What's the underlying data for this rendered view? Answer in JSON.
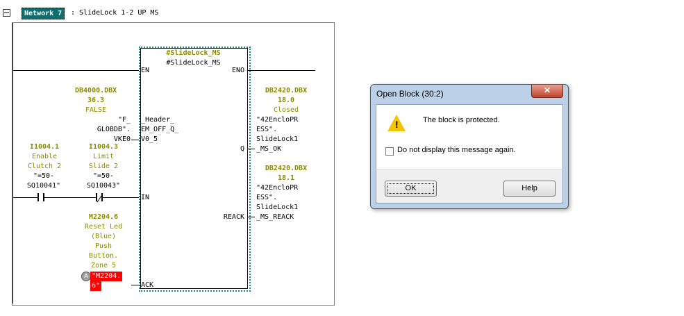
{
  "network": {
    "tag": "Network 7",
    "title": ": SlideLock 1-2 UP MS"
  },
  "block": {
    "instance_db": "#SlideLock_MS",
    "instance_name": "#SlideLock_MS",
    "pin_en": "EN",
    "pin_eno": "ENO",
    "pin_header": "_Header_\nEM_OFF_Q_\nV0_5",
    "pin_q": "Q",
    "pin_in": "IN",
    "pin_reack": "REACK",
    "pin_ack": "ACK"
  },
  "operands": {
    "db4000_addr": "DB4000.DBX\n36.3",
    "db4000_state": "FALSE",
    "db4000_sym": "\"F_\nGLOBDB\".\nVKE0",
    "i1004_1_addr": "I1004.1",
    "i1004_1_desc": "Enable\nClutch 2",
    "i1004_1_sym": "\"=50-\nSQ10041\"",
    "i1004_3_addr": "I1004.3",
    "i1004_3_desc": "Limit\nSlide 2",
    "i1004_3_sym": "\"=50-\nSQ10043\"",
    "m2204_addr": "M2204.6",
    "m2204_desc": "Reset Led\n(Blue)\nPush\nButton.\nZone 5",
    "m2204_sym_a": "\"M2204.",
    "m2204_sym_b": "6\"",
    "db2420_180_addr": "DB2420.DBX\n18.0",
    "db2420_180_state": "Closed",
    "db2420_180_sym": "\"42EncloPR\nESS\".\nSlideLock1\n_MS_OK",
    "db2420_181_addr": "DB2420.DBX\n18.1",
    "db2420_181_sym": "\"42EncloPR\nESS\".\nSlideLock1\n_MS_REACK"
  },
  "status_icon": "A",
  "dialog": {
    "title": "Open Block (30:2)",
    "close": "✕",
    "message": "The block is protected.",
    "checkbox_label": "Do not display this message again.",
    "ok_label": "OK",
    "help_label": "Help",
    "warning_icon": "warning-triangle-icon"
  },
  "colors": {
    "network_tag_bg": "#106e6e",
    "operand_label": "#8c8c00",
    "fb_border": "#0f8a8a",
    "highlight": "#ff0000",
    "dialog_frame": "#bcd0e8"
  }
}
